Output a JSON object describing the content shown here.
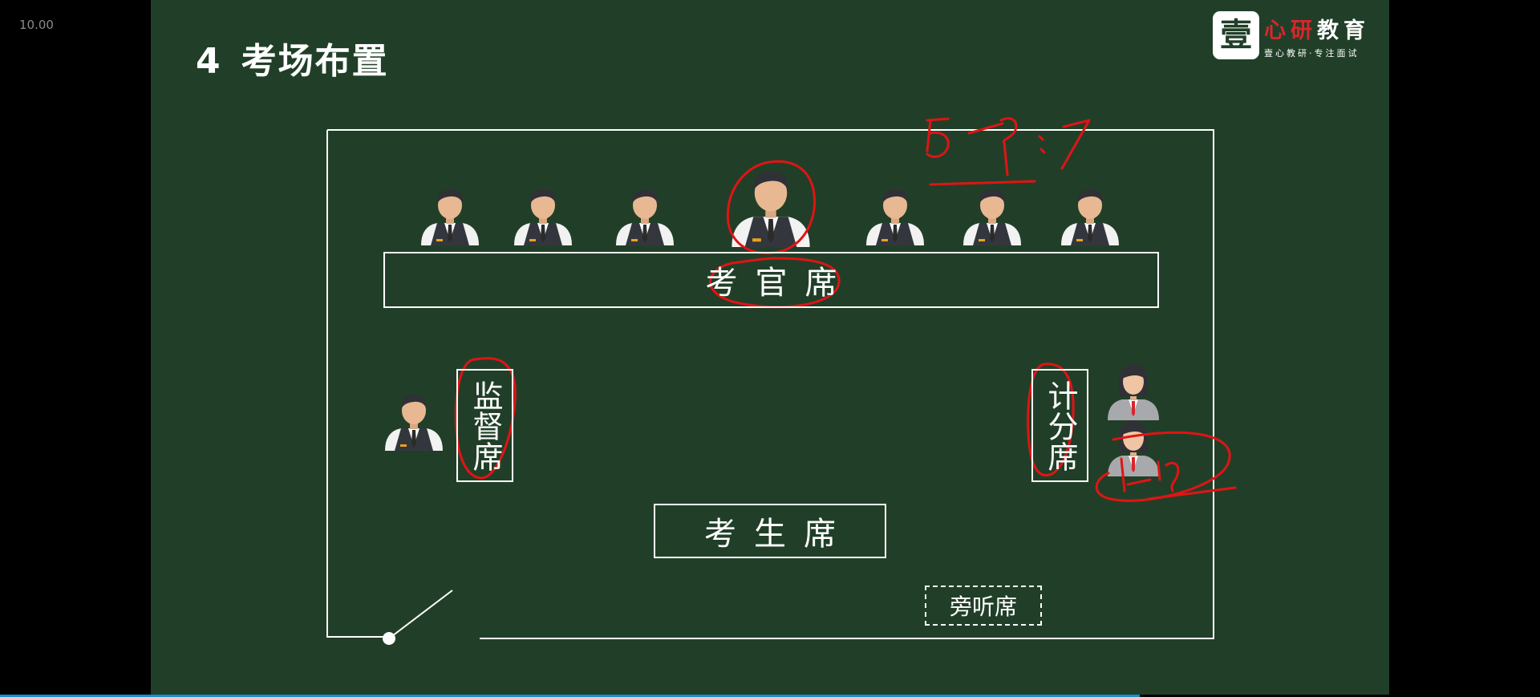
{
  "player": {
    "timestamp": "10.00",
    "progress_fraction": 0.74
  },
  "slide": {
    "title_number": "4",
    "title_text": "考场布置",
    "logo": {
      "mark": "壹",
      "name_red": "心研",
      "name_white": "教育",
      "tagline": "壹心教研·专注面试"
    },
    "seats": {
      "examiner": "考官席",
      "supervisor": "监督席",
      "scorer": "计分席",
      "candidate": "考生席",
      "audience": "旁听席"
    },
    "people": {
      "examiners_count": 7,
      "chief_examiner_index": 3,
      "supervisor_count": 1,
      "scorer_count": 2
    },
    "annotations": {
      "handwritten_ratio": "5-9:7",
      "handwritten_near_scorers": "1-2"
    },
    "colors": {
      "slide_bg": "#213f28",
      "ink": "#e01414",
      "line": "#ffffff",
      "logo_red": "#d9262b"
    }
  }
}
